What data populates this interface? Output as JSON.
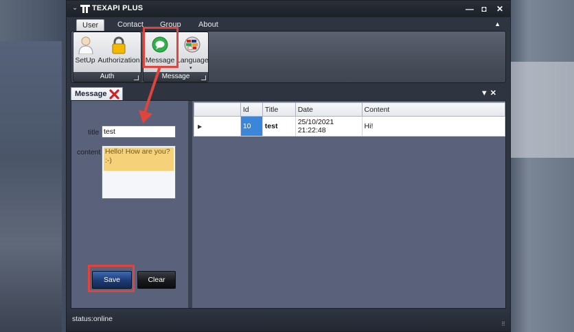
{
  "window": {
    "title": "TEXAPI PLUS"
  },
  "ribbon_tabs": [
    "User",
    "Contact",
    "Group",
    "About"
  ],
  "ribbon": {
    "groups": [
      {
        "name": "Auth",
        "buttons": [
          "SetUp",
          "Authorization"
        ]
      },
      {
        "name": "Message",
        "buttons": [
          "Message",
          "Language"
        ]
      }
    ]
  },
  "document_tab": {
    "label": "Message"
  },
  "form": {
    "title_label": "title",
    "title_value": "test",
    "content_label": "content",
    "content_value": "Hello! How are you?\n:-)",
    "save_label": "Save",
    "clear_label": "Clear"
  },
  "grid": {
    "columns": [
      "Id",
      "Title",
      "Date",
      "Content"
    ],
    "rows": [
      {
        "Id": "10",
        "Title": "test",
        "Date": "25/10/2021 21:22:48",
        "Content": "Hi!"
      }
    ]
  },
  "status": {
    "text": "status:online"
  },
  "colors": {
    "highlight": "#e0443a",
    "selection": "#3b86d8",
    "content_highlight": "#f5d27a"
  }
}
